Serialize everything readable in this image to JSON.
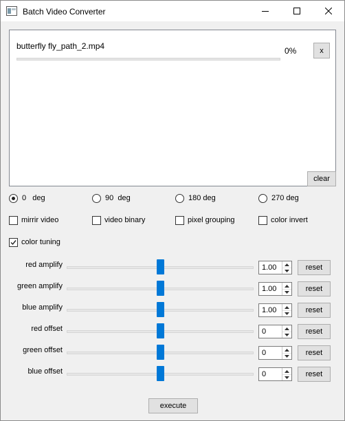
{
  "window": {
    "title": "Batch Video Converter",
    "controls": [
      "minimize-icon",
      "maximize-icon",
      "close-icon"
    ]
  },
  "file_list": {
    "items": [
      {
        "name": "butterfly fly_path_2.mp4",
        "progress_label": "0%",
        "progress": 0,
        "remove_label": "x"
      }
    ],
    "clear_label": "clear"
  },
  "rotation": {
    "options": [
      {
        "label": "0   deg",
        "checked": true
      },
      {
        "label": "90  deg",
        "checked": false
      },
      {
        "label": "180 deg",
        "checked": false
      },
      {
        "label": "270 deg",
        "checked": false
      }
    ]
  },
  "options": [
    {
      "label": "mirrir video",
      "checked": false
    },
    {
      "label": "video binary",
      "checked": false
    },
    {
      "label": "pixel grouping",
      "checked": false
    },
    {
      "label": "color invert",
      "checked": false
    }
  ],
  "color_tuning": {
    "label": "color tuning",
    "checked": true
  },
  "sliders": [
    {
      "label": "red amplify",
      "value": "1.00",
      "position": 0.5,
      "reset_label": "reset"
    },
    {
      "label": "green amplify",
      "value": "1.00",
      "position": 0.5,
      "reset_label": "reset"
    },
    {
      "label": "blue amplify",
      "value": "1.00",
      "position": 0.5,
      "reset_label": "reset"
    },
    {
      "label": "red offset",
      "value": "0",
      "position": 0.5,
      "reset_label": "reset"
    },
    {
      "label": "green offset",
      "value": "0",
      "position": 0.5,
      "reset_label": "reset"
    },
    {
      "label": "blue offset",
      "value": "0",
      "position": 0.5,
      "reset_label": "reset"
    }
  ],
  "execute_label": "execute",
  "colors": {
    "accent": "#0078d7",
    "progress": "#06b025"
  }
}
